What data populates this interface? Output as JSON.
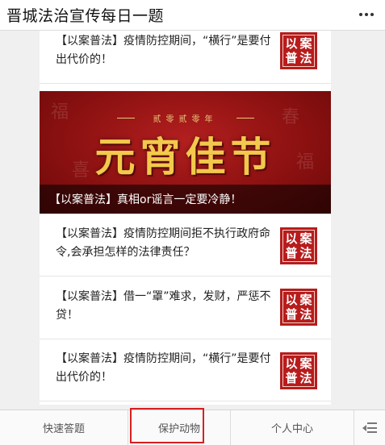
{
  "header": {
    "title": "晋城法治宣传每日一题",
    "more_icon": "more-dots-icon"
  },
  "badge": {
    "line1": "以案",
    "line2": "普法",
    "color": "#b71c1c"
  },
  "articles": [
    {
      "title": "【以案普法】疫情防控期间，“横行”是要付出代价的！"
    },
    {
      "title": "【以案普法】疫情防控期间拒不执行政府命令,会承担怎样的法律责任？"
    },
    {
      "title": "【以案普法】借一“罩”难求，发财，严惩不贷！"
    },
    {
      "title": "【以案普法】疫情防控期间，“横行”是要付出代价的！"
    }
  ],
  "banner": {
    "top_text": "贰零贰零年",
    "festival_text": "元宵佳节",
    "caption": "【以案普法】真相or谣言一定要冷静！",
    "bg_color": "#8a1010",
    "text_color": "#f2c94c"
  },
  "tabbar": {
    "tabs": [
      {
        "label": "快速答题"
      },
      {
        "label": "保护动物",
        "highlighted": true
      },
      {
        "label": "个人中心"
      }
    ],
    "keyboard_icon": "keyboard-toggle-icon",
    "highlight_color": "#d62020"
  }
}
